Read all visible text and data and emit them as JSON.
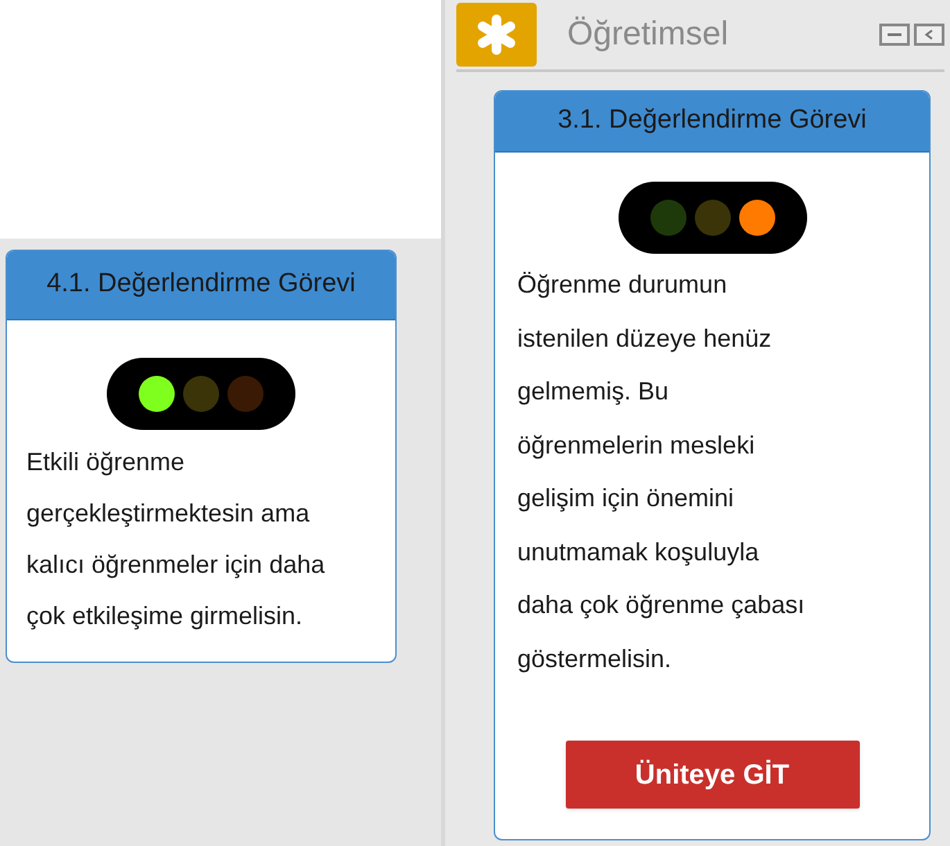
{
  "left_card": {
    "title": "4.1. Değerlendirme Görevi",
    "lights": [
      {
        "kind": "green",
        "on": true
      },
      {
        "kind": "yellow",
        "on": false
      },
      {
        "kind": "red",
        "on": false
      }
    ],
    "message": "Etkili öğrenme gerçekleştirmektesin ama kalıcı öğrenmeler için daha çok etkileşime girmelisin."
  },
  "panel": {
    "title": "Öğretimsel",
    "expanded": true,
    "card": {
      "title": "3.1. Değerlendirme Görevi",
      "lights": [
        {
          "kind": "green",
          "on": false
        },
        {
          "kind": "yellow",
          "on": false
        },
        {
          "kind": "red",
          "on": true
        }
      ],
      "message": "Öğrenme durumun istenilen düzeye henüz gelmemiş. Bu öğrenmelerin mesleki gelişim için önemini unutmamak koşuluyla daha çok öğrenme çabası göstermelisin.",
      "button": "Üniteye GİT"
    }
  }
}
